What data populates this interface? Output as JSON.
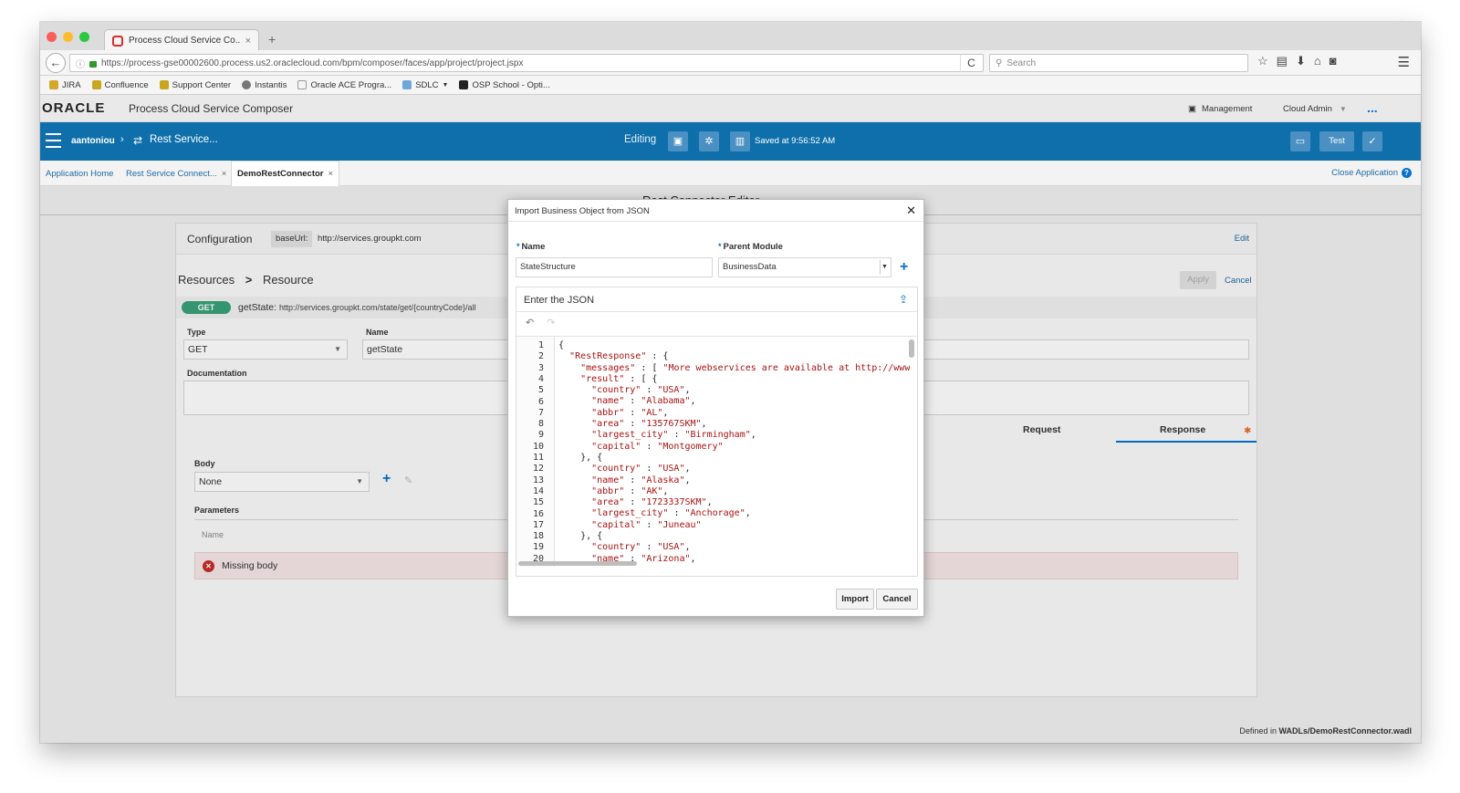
{
  "browser": {
    "tab_title": "Process Cloud Service Co...",
    "url": "https://process-gse00002600.process.us2.oraclecloud.com/bpm/composer/faces/app/project/project.jspx",
    "search_placeholder": "Search",
    "bookmarks": [
      "JIRA",
      "Confluence",
      "Support Center",
      "Instantis",
      "Oracle ACE Progra...",
      "SDLC",
      "OSP School - Opti..."
    ]
  },
  "app": {
    "logo": "ORACLE",
    "title": "Process Cloud Service Composer",
    "management": "Management",
    "user_menu": "Cloud Admin",
    "more": "...",
    "username": "aantoniou",
    "breadcrumb_title": "Rest Service...",
    "editing": "Editing",
    "saved": "Saved at 9:56:52 AM",
    "test": "Test"
  },
  "tabs": {
    "items": [
      {
        "label": "Application Home"
      },
      {
        "label": "Rest Service Connect..."
      },
      {
        "label": "DemoRestConnector"
      }
    ],
    "close_app": "Close Application"
  },
  "background": {
    "page_title": "Rest Connector Editor",
    "config_label": "Configuration",
    "base_url_label": "baseUrl:",
    "base_url": "http://services.groupkt.com",
    "edit": "Edit",
    "crumb_resources": "Resources",
    "crumb_sep": ">",
    "crumb_resource": "Resource",
    "apply": "Apply",
    "cancel": "Cancel",
    "method": "GET",
    "op_name": "getState:",
    "op_path": "http://services.groupkt.com/state/get/{countryCode}/all",
    "type_label": "Type",
    "type_value": "GET",
    "name_label": "Name",
    "name_value": "getState",
    "doc_label": "Documentation",
    "request_tab": "Request",
    "response_tab": "Response",
    "body_label": "Body",
    "body_value": "None",
    "params_label": "Parameters",
    "name_col": "Name",
    "missing_body": "Missing body",
    "defined_in_prefix": "Defined in",
    "defined_in_file": "WADLs/DemoRestConnector.wadl"
  },
  "modal": {
    "title": "Import Business Object from JSON",
    "name_label": "Name",
    "name_value": "StateStructure",
    "parent_label": "Parent Module",
    "parent_value": "BusinessData",
    "json_label": "Enter the JSON",
    "import": "Import",
    "cancel": "Cancel",
    "code_lines": [
      "{",
      "  \"RestResponse\" : {",
      "    \"messages\" : [ \"More webservices are available at http://www",
      "    \"result\" : [ {",
      "      \"country\" : \"USA\",",
      "      \"name\" : \"Alabama\",",
      "      \"abbr\" : \"AL\",",
      "      \"area\" : \"135767SKM\",",
      "      \"largest_city\" : \"Birmingham\",",
      "      \"capital\" : \"Montgomery\"",
      "    }, {",
      "      \"country\" : \"USA\",",
      "      \"name\" : \"Alaska\",",
      "      \"abbr\" : \"AK\",",
      "      \"area\" : \"1723337SKM\",",
      "      \"largest_city\" : \"Anchorage\",",
      "      \"capital\" : \"Juneau\"",
      "    }, {",
      "      \"country\" : \"USA\",",
      "      \"name\" : \"Arizona\","
    ]
  }
}
